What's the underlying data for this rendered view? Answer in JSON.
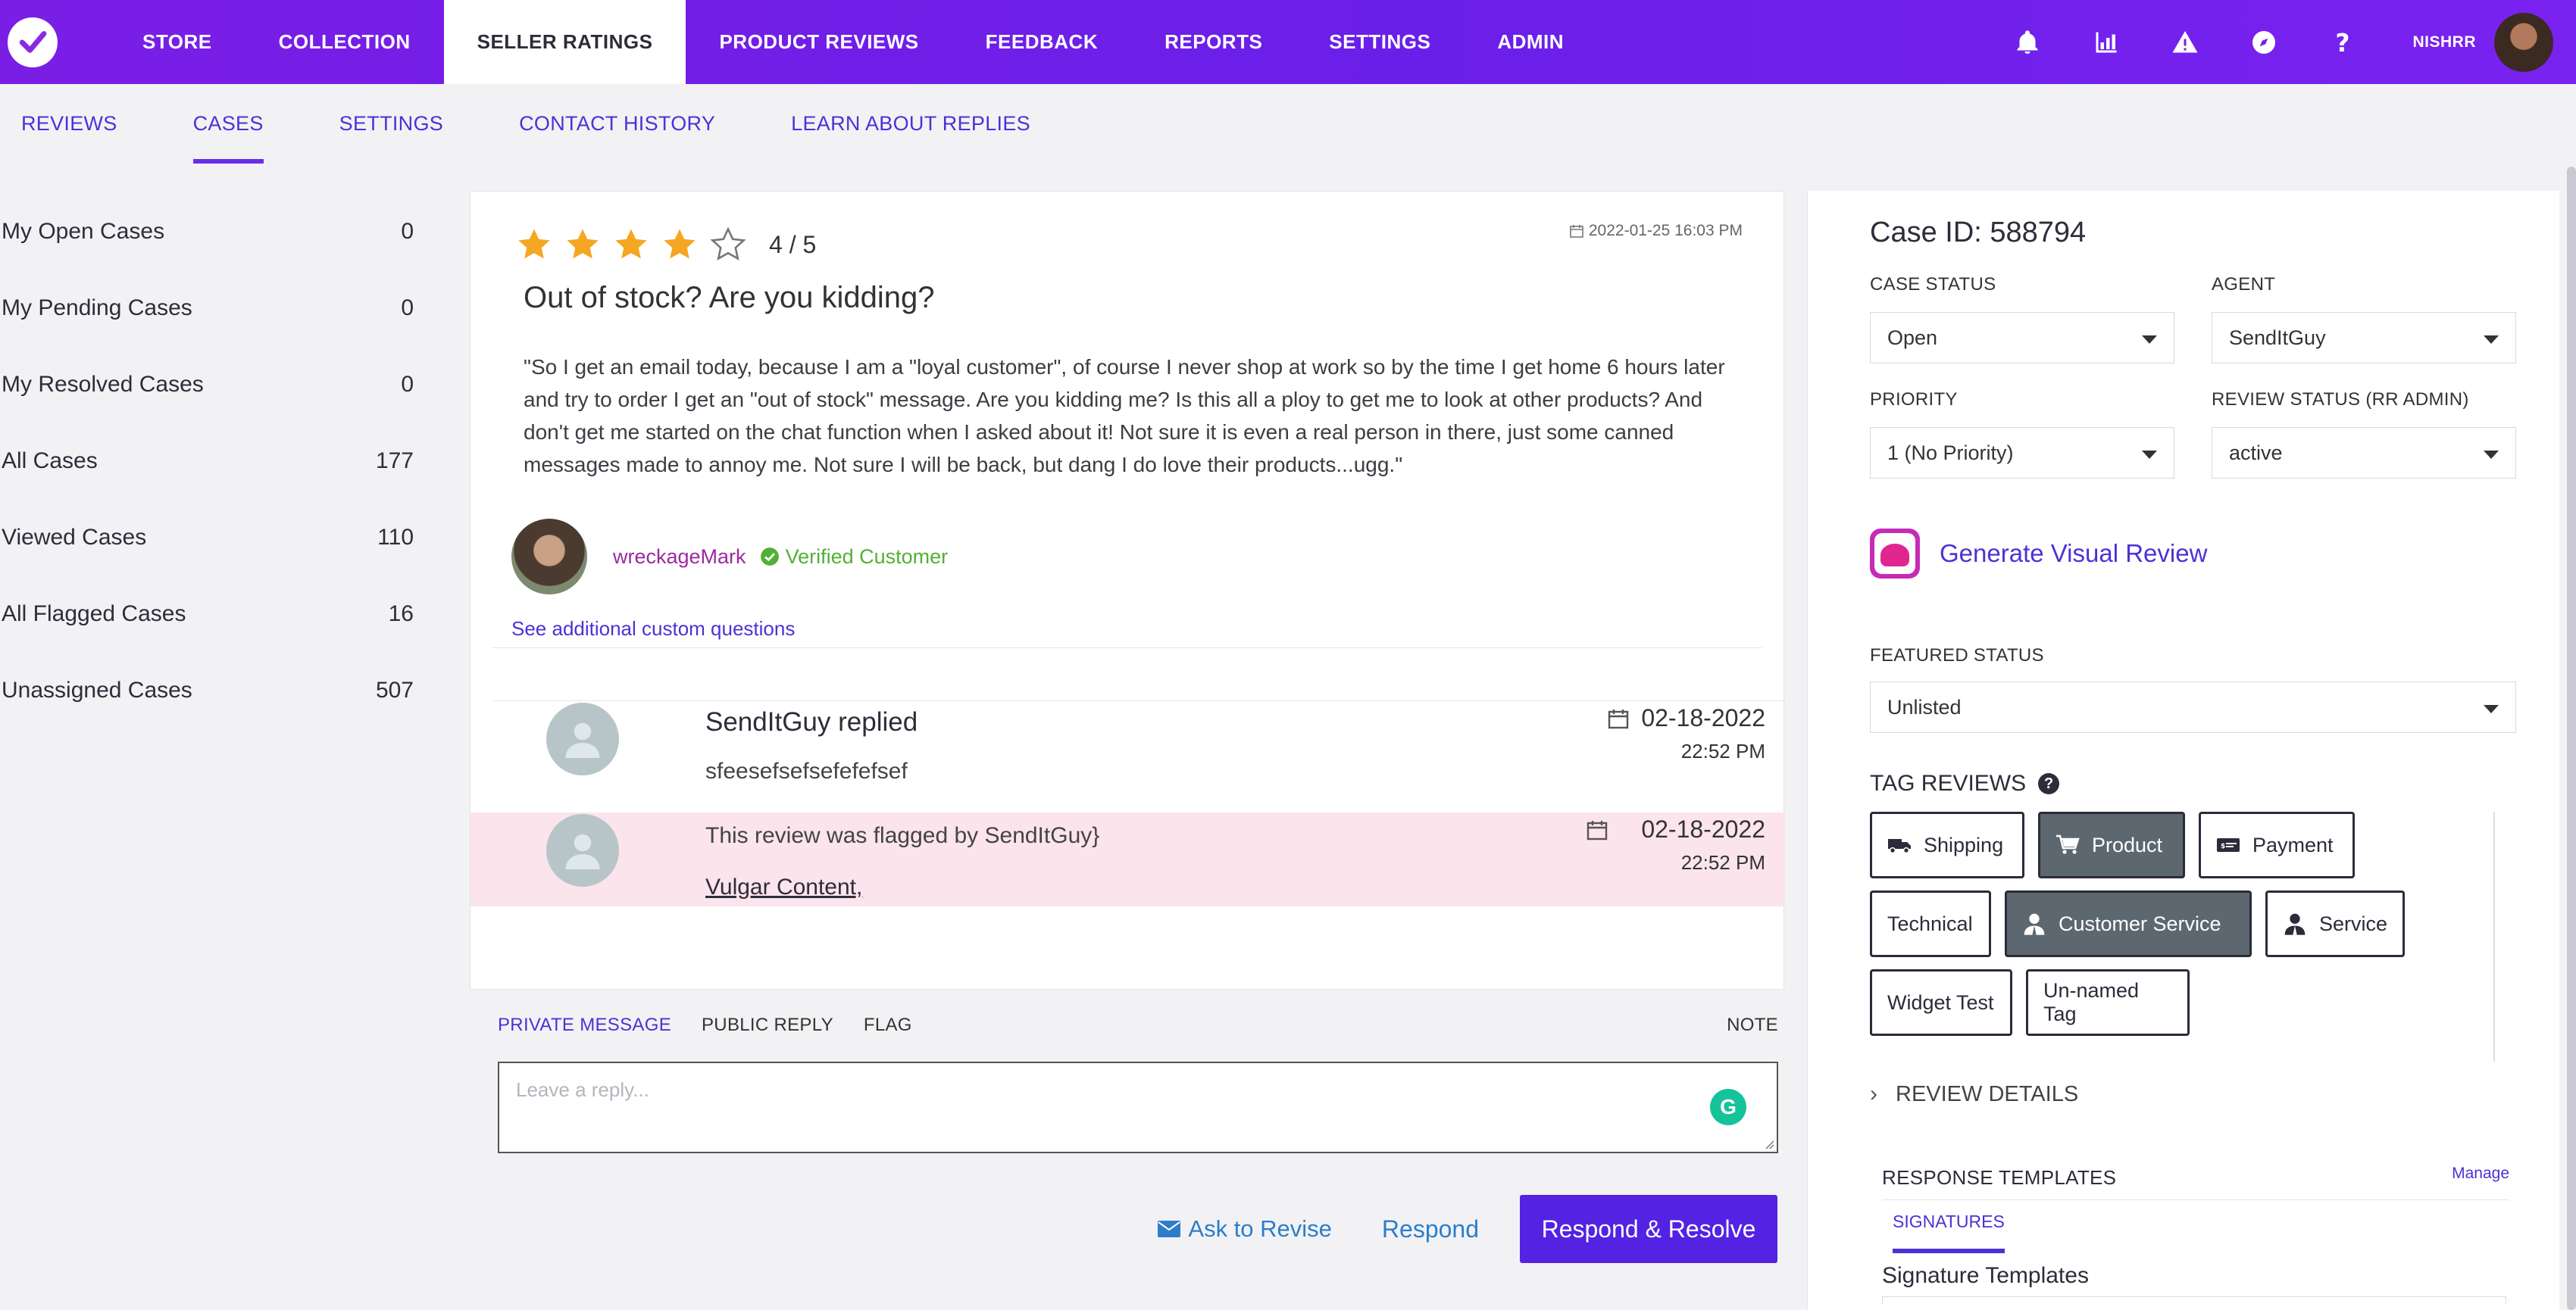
{
  "topnav": {
    "items": [
      "STORE",
      "COLLECTION",
      "SELLER RATINGS",
      "PRODUCT REVIEWS",
      "FEEDBACK",
      "REPORTS",
      "SETTINGS",
      "ADMIN"
    ],
    "active_index": 2,
    "user_name": "NISHRR",
    "icons": [
      "bell-icon",
      "bar-chart-icon",
      "warning-icon",
      "compass-icon",
      "help-icon"
    ]
  },
  "subnav": {
    "items": [
      "REVIEWS",
      "CASES",
      "SETTINGS",
      "CONTACT HISTORY",
      "LEARN ABOUT REPLIES"
    ],
    "active_index": 1
  },
  "sidebar": {
    "items": [
      {
        "label": "My Open Cases",
        "count": "0"
      },
      {
        "label": "My Pending Cases",
        "count": "0"
      },
      {
        "label": "My Resolved Cases",
        "count": "0"
      },
      {
        "label": "All Cases",
        "count": "177"
      },
      {
        "label": "Viewed Cases",
        "count": "110"
      },
      {
        "label": "All Flagged Cases",
        "count": "16"
      },
      {
        "label": "Unassigned Cases",
        "count": "507"
      }
    ]
  },
  "review": {
    "rating": 4,
    "rating_max": 5,
    "rating_text": "4 / 5",
    "date": "2022-01-25 16:03 PM",
    "title": "Out of stock? Are you kidding?",
    "body": "\"So I get an email today, because I am a \"loyal customer\", of course I never shop at work so by the time I get home 6 hours later and try to order I get an \"out of stock\" message. Are you kidding me? Is this all a ploy to get me to look at other products? And don't get me started on the chat function when I asked about it! Not sure it is even a real person in there, just some canned messages made to annoy me. Not sure I will be back, but dang I do love their products...ugg.\"",
    "reviewer": "wreckageMark",
    "verified_label": "Verified Customer",
    "custom_questions_link": "See additional custom questions",
    "colors": {
      "star": "#f5a623",
      "verified": "#52b035",
      "reviewer": "#9b2aa0"
    }
  },
  "thread": [
    {
      "title": "SendItGuy replied",
      "text": "sfeesefsefsefefefsef",
      "date": "02-18-2022",
      "time": "22:52 PM"
    },
    {
      "title": "This review was flagged by SendItGuy}",
      "text": "Vulgar Content,",
      "date": "02-18-2022",
      "time": "22:52 PM"
    }
  ],
  "reply": {
    "tabs": [
      "PRIVATE MESSAGE",
      "PUBLIC REPLY",
      "FLAG"
    ],
    "note_label": "NOTE",
    "placeholder": "Leave a reply...",
    "ask_revise": "Ask to Revise",
    "respond": "Respond",
    "respond_resolve": "Respond & Resolve"
  },
  "case": {
    "id_text": "Case ID: 588794",
    "status_label": "CASE STATUS",
    "status_value": "Open",
    "agent_label": "AGENT",
    "agent_value": "SendItGuy",
    "priority_label": "PRIORITY",
    "priority_value": "1 (No Priority)",
    "review_status_label": "REVIEW STATUS (RR ADMIN)",
    "review_status_value": "active",
    "generate_visual": "Generate Visual Review",
    "featured_label": "FEATURED STATUS",
    "featured_value": "Unlisted",
    "tag_reviews_label": "TAG REVIEWS",
    "tags": [
      {
        "label": "Shipping",
        "icon": "truck-icon",
        "active": false
      },
      {
        "label": "Product",
        "icon": "cart-icon",
        "active": true
      },
      {
        "label": "Payment",
        "icon": "payment-icon",
        "active": false
      },
      {
        "label": "Technical",
        "icon": "",
        "active": false
      },
      {
        "label": "Customer Service",
        "icon": "person-icon",
        "active": true
      },
      {
        "label": "Service",
        "icon": "person-icon",
        "active": false
      },
      {
        "label": "Widget Test",
        "icon": "",
        "active": false
      },
      {
        "label": "Un-named Tag",
        "icon": "",
        "active": false
      }
    ],
    "review_details_label": "REVIEW DETAILS",
    "response_templates_label": "RESPONSE TEMPLATES",
    "manage_label": "Manage",
    "signatures_tab": "SIGNATURES",
    "signature_templates_label": "Signature Templates"
  },
  "colors": {
    "nav_gradient_start": "#7a1ee6",
    "accent": "#4d31d6",
    "primary_button": "#5322e2",
    "link_blue": "#2c7ec9",
    "flag_row_bg": "#fbe4ec"
  }
}
